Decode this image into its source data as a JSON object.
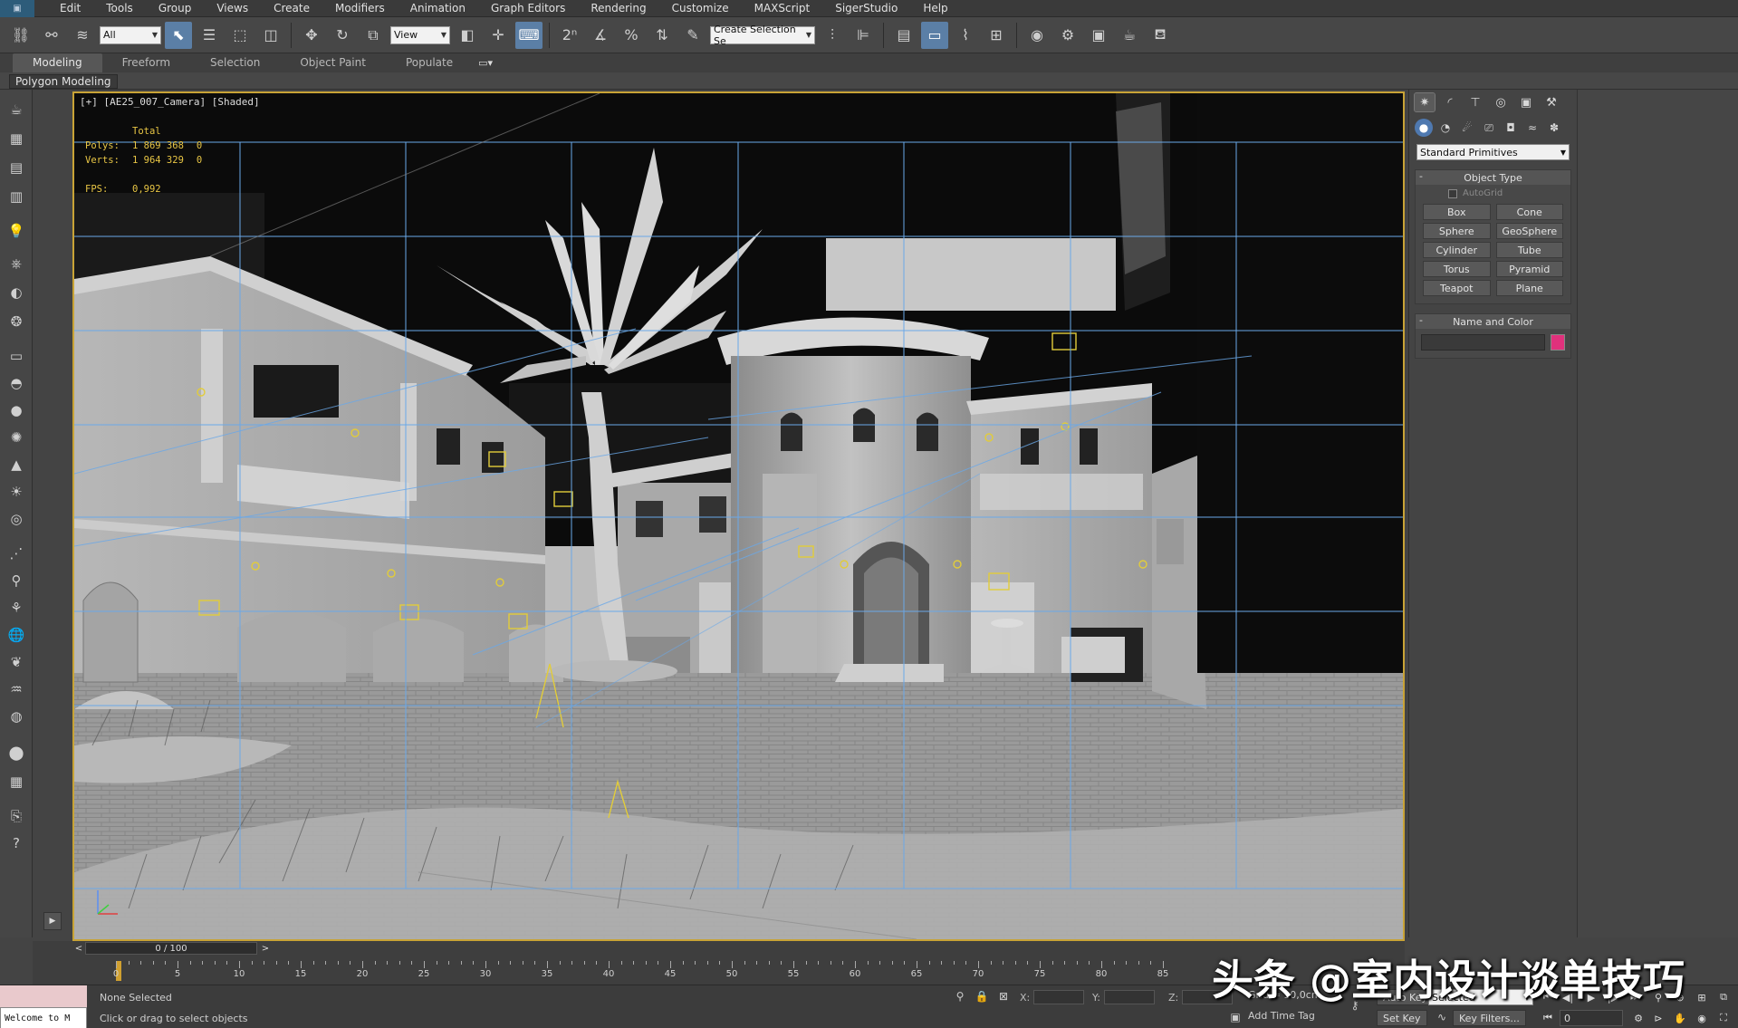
{
  "menu": {
    "items": [
      "Edit",
      "Tools",
      "Group",
      "Views",
      "Create",
      "Modifiers",
      "Animation",
      "Graph Editors",
      "Rendering",
      "Customize",
      "MAXScript",
      "SigerStudio",
      "Help"
    ]
  },
  "toolbar": {
    "selection_filter": "All",
    "reference_coord": "View",
    "named_selection": "Create Selection Se"
  },
  "ribbon": {
    "tabs": [
      "Modeling",
      "Freeform",
      "Selection",
      "Object Paint",
      "Populate"
    ],
    "active_tab": "Modeling",
    "sub_label": "Polygon Modeling"
  },
  "viewport": {
    "label": "[+] [AE25_007_Camera] [Shaded]",
    "stats": {
      "header": "Total",
      "polys_label": "Polys:",
      "polys_value": "1 869 368",
      "polys_sel": "0",
      "verts_label": "Verts:",
      "verts_value": "1 964 329",
      "verts_sel": "0",
      "fps_label": "FPS:",
      "fps_value": "0,992"
    },
    "frame_color": "#c8a336",
    "grid_color": "#6aa8e8"
  },
  "command_panel": {
    "dropdown": "Standard Primitives",
    "object_type": {
      "title": "Object Type",
      "autogrid": "AutoGrid",
      "buttons": [
        "Box",
        "Cone",
        "Sphere",
        "GeoSphere",
        "Cylinder",
        "Tube",
        "Torus",
        "Pyramid",
        "Teapot",
        "Plane"
      ]
    },
    "name_color": {
      "title": "Name and Color",
      "swatch_color": "#e0317c"
    }
  },
  "timeline": {
    "slider": "0 / 100",
    "ticks": [
      "0",
      "5",
      "10",
      "15",
      "20",
      "25",
      "30",
      "35",
      "40",
      "45",
      "50",
      "55",
      "60",
      "65",
      "70",
      "75",
      "80",
      "85"
    ]
  },
  "status": {
    "listener": "Welcome to M",
    "selection": "None Selected",
    "prompt": "Click or drag to select objects",
    "x_label": "X:",
    "y_label": "Y:",
    "z_label": "Z:",
    "grid": "Grid = 10,0cm",
    "add_time_tag": "Add Time Tag",
    "auto_key": "Auto Key",
    "set_key": "Set Key",
    "key_mode": "Selected",
    "key_filters": "Key Filters...",
    "frame": "0"
  },
  "watermark": "头条 @室内设计谈单技巧"
}
